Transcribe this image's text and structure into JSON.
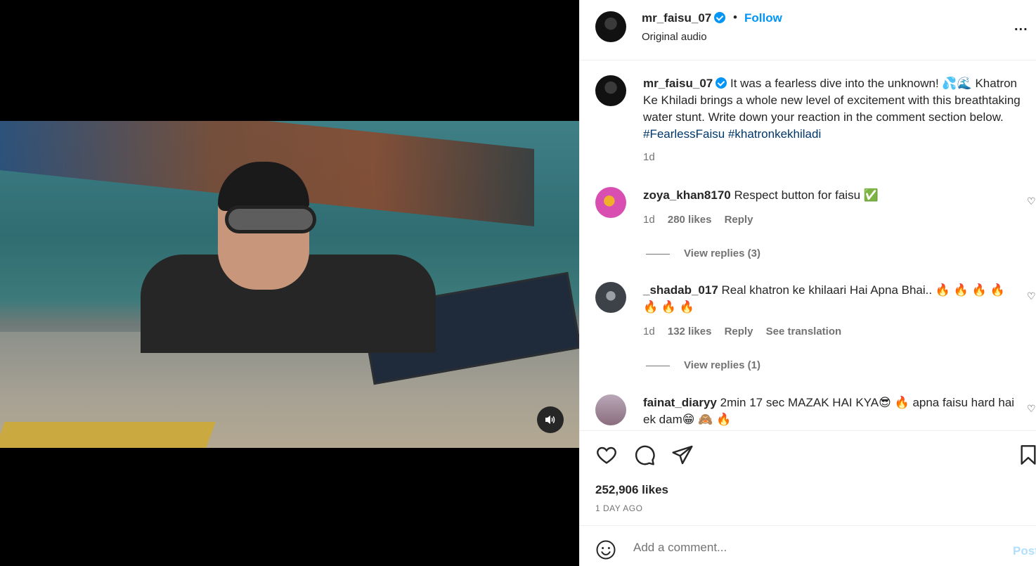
{
  "post": {
    "username": "mr_faisu_07",
    "dot": "•",
    "follow_label": "Follow",
    "audio": "Original audio",
    "more_label": "..."
  },
  "caption": {
    "username": "mr_faisu_07",
    "text": "It was a fearless dive into the unknown! 💦🌊 Khatron Ke Khiladi brings a whole new level of excitement with this breathtaking water stunt. Write down your reaction in the comment section below. ",
    "tags": "#FearlessFaisu #khatronkekhiladi",
    "time": "1d"
  },
  "comments": [
    {
      "username": "zoya_khan8170",
      "text": "Respect button for faisu ✅",
      "time": "1d",
      "likes": "280 likes",
      "reply": "Reply",
      "view_replies": "View replies (3)"
    },
    {
      "username": "_shadab_017",
      "text": "Real khatron ke khilaari Hai Apna Bhai.. 🔥 🔥 🔥 🔥 🔥 🔥 🔥",
      "time": "1d",
      "likes": "132 likes",
      "reply": "Reply",
      "translation": "See translation",
      "view_replies": "View replies (1)"
    },
    {
      "username": "fainat_diaryy",
      "text": "2min 17 sec MAZAK HAI KYA😎 🔥 apna faisu hard hai ek dam😁 🙈 🔥"
    }
  ],
  "footer": {
    "likes": "252,906 likes",
    "ago": "1 DAY AGO",
    "comment_placeholder": "Add a comment...",
    "post_label": "Post"
  },
  "colors": {
    "accent": "#0095f6",
    "text": "#262626",
    "muted": "#737373"
  }
}
